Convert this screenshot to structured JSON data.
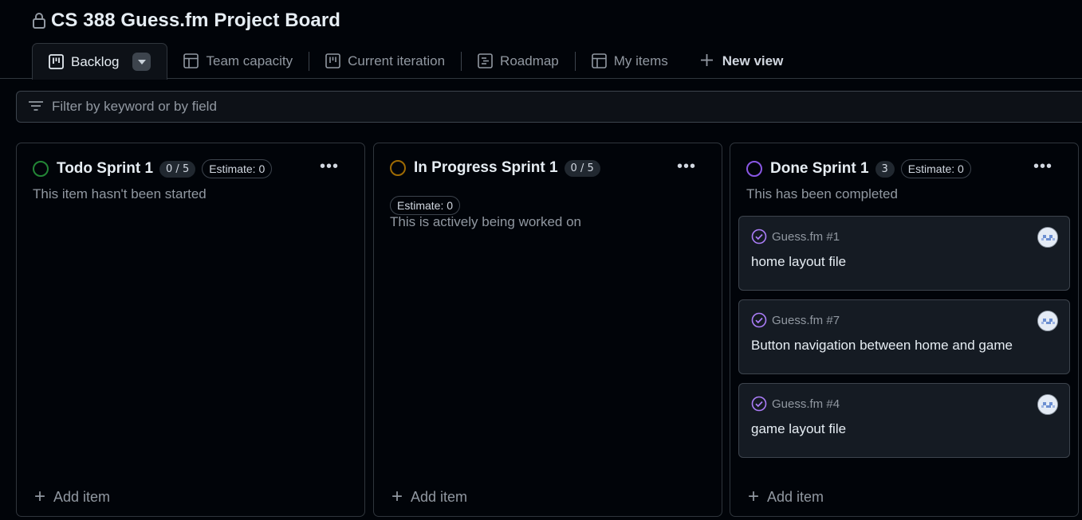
{
  "project": {
    "title": "CS 388 Guess.fm Project Board",
    "visibility_icon": "lock-icon"
  },
  "tabs": [
    {
      "label": "Backlog",
      "icon": "board-icon",
      "active": true
    },
    {
      "label": "Team capacity",
      "icon": "table-icon"
    },
    {
      "label": "Current iteration",
      "icon": "board-icon"
    },
    {
      "label": "Roadmap",
      "icon": "roadmap-icon"
    },
    {
      "label": "My items",
      "icon": "table-icon"
    },
    {
      "label": "New view",
      "icon": "plus-icon"
    }
  ],
  "filter": {
    "placeholder": "Filter by keyword or by field",
    "value": ""
  },
  "columns": [
    {
      "name": "Todo Sprint 1",
      "count": "0 / 5",
      "estimate": "Estimate: 0",
      "description": "This item hasn't been started",
      "status_color": "#238636",
      "add_label": "Add item",
      "cards": []
    },
    {
      "name": "In Progress Sprint 1",
      "count": "0 / 5",
      "estimate": "Estimate: 0",
      "description": "This is actively being worked on",
      "status_color": "#9e6a03",
      "add_label": "Add item",
      "cards": []
    },
    {
      "name": "Done Sprint 1",
      "count": "3",
      "estimate": "Estimate: 0",
      "description": "This has been completed",
      "status_color": "#8957e5",
      "add_label": "Add item",
      "cards": [
        {
          "ref": "Guess.fm #1",
          "title": "home layout file"
        },
        {
          "ref": "Guess.fm #7",
          "title": "Button navigation between home and game"
        },
        {
          "ref": "Guess.fm #4",
          "title": "game layout file"
        }
      ]
    }
  ],
  "colors": {
    "background": "#010409",
    "panel": "#0d1117",
    "card": "#151b23",
    "border": "#30363d",
    "done_purple": "#ab7df8"
  }
}
